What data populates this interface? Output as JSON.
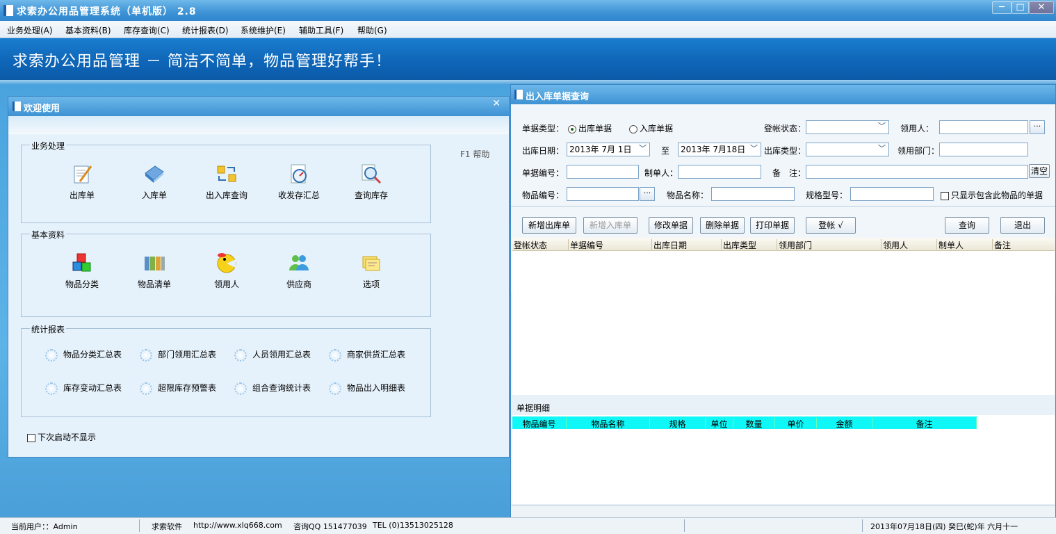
{
  "window": {
    "title": "求索办公用品管理系统（单机版） 2.8",
    "minimize": "─",
    "maximize": "□",
    "close": "✕"
  },
  "menu": [
    "业务处理(A)",
    "基本资料(B)",
    "库存查询(C)",
    "统计报表(D)",
    "系统维护(E)",
    "辅助工具(F)",
    "帮助(G)"
  ],
  "banner": {
    "slogan": "求索办公用品管理 － 简洁不简单，物品管理好帮手！"
  },
  "welcome": {
    "title": "欢迎使用",
    "close": "✕",
    "help": "F1 帮助",
    "groups": {
      "business": {
        "label": "业务处理",
        "items": [
          "出库单",
          "入库单",
          "出入库查询",
          "收发存汇总",
          "查询库存"
        ]
      },
      "basic": {
        "label": "基本资料",
        "items": [
          "物品分类",
          "物品清单",
          "领用人",
          "供应商",
          "选项"
        ]
      },
      "reports": {
        "label": "统计报表",
        "items": [
          "物品分类汇总表",
          "部门领用汇总表",
          "人员领用汇总表",
          "商家供货汇总表",
          "库存变动汇总表",
          "超限库存预警表",
          "组合查询统计表",
          "物品出入明细表"
        ]
      }
    },
    "no_show_next": "下次启动不显示"
  },
  "query": {
    "title": "出入库单据查询",
    "form": {
      "doc_type_label": "单据类型：",
      "radio_out": "出库单据",
      "radio_in": "入库单据",
      "post_status_label": "登帐状态：",
      "recipient_label": "领用人：",
      "out_date_label": "出库日期：",
      "date_from": "2013年 7月 1日",
      "to_label": "至",
      "date_to": "2013年 7月18日",
      "out_type_label": "出库类型：",
      "dept_label": "领用部门：",
      "doc_no_label": "单据编号：",
      "maker_label": "制单人：",
      "remark_label": "备　注：",
      "clear_label": "清空",
      "item_no_label": "物品编号：",
      "item_name_label": "物品名称：",
      "spec_label": "规格型号：",
      "only_show_label": "只显示包含此物品的单据",
      "ellipsis": "···"
    },
    "buttons": {
      "new_out": "新增出库单",
      "new_in": "新增入库单",
      "edit": "修改单据",
      "delete": "删除单据",
      "print": "打印单据",
      "post": "登帐 √",
      "search": "查询",
      "exit": "退出"
    },
    "grid_columns": [
      "登帐状态",
      "单据编号",
      "出库日期",
      "出库类型",
      "领用部门",
      "领用人",
      "制单人",
      "备注"
    ],
    "detail_label": "单据明细",
    "detail_columns": [
      "物品编号",
      "物品名称",
      "规格",
      "单位",
      "数量",
      "单价",
      "金额",
      "备注"
    ]
  },
  "status": {
    "user": "当前用户：：Admin",
    "company": "求索软件",
    "url": "http://www.xlq668.com",
    "qq": "咨询QQ 151477039",
    "tel": "TEL (0)13513025128",
    "date": "2013年07月18日(四) 癸巳(蛇)年 六月十一"
  },
  "colors": {
    "titlebar": "#3d93d5",
    "banner": "#0f66b8",
    "detail_header": "#0ff7f7"
  }
}
